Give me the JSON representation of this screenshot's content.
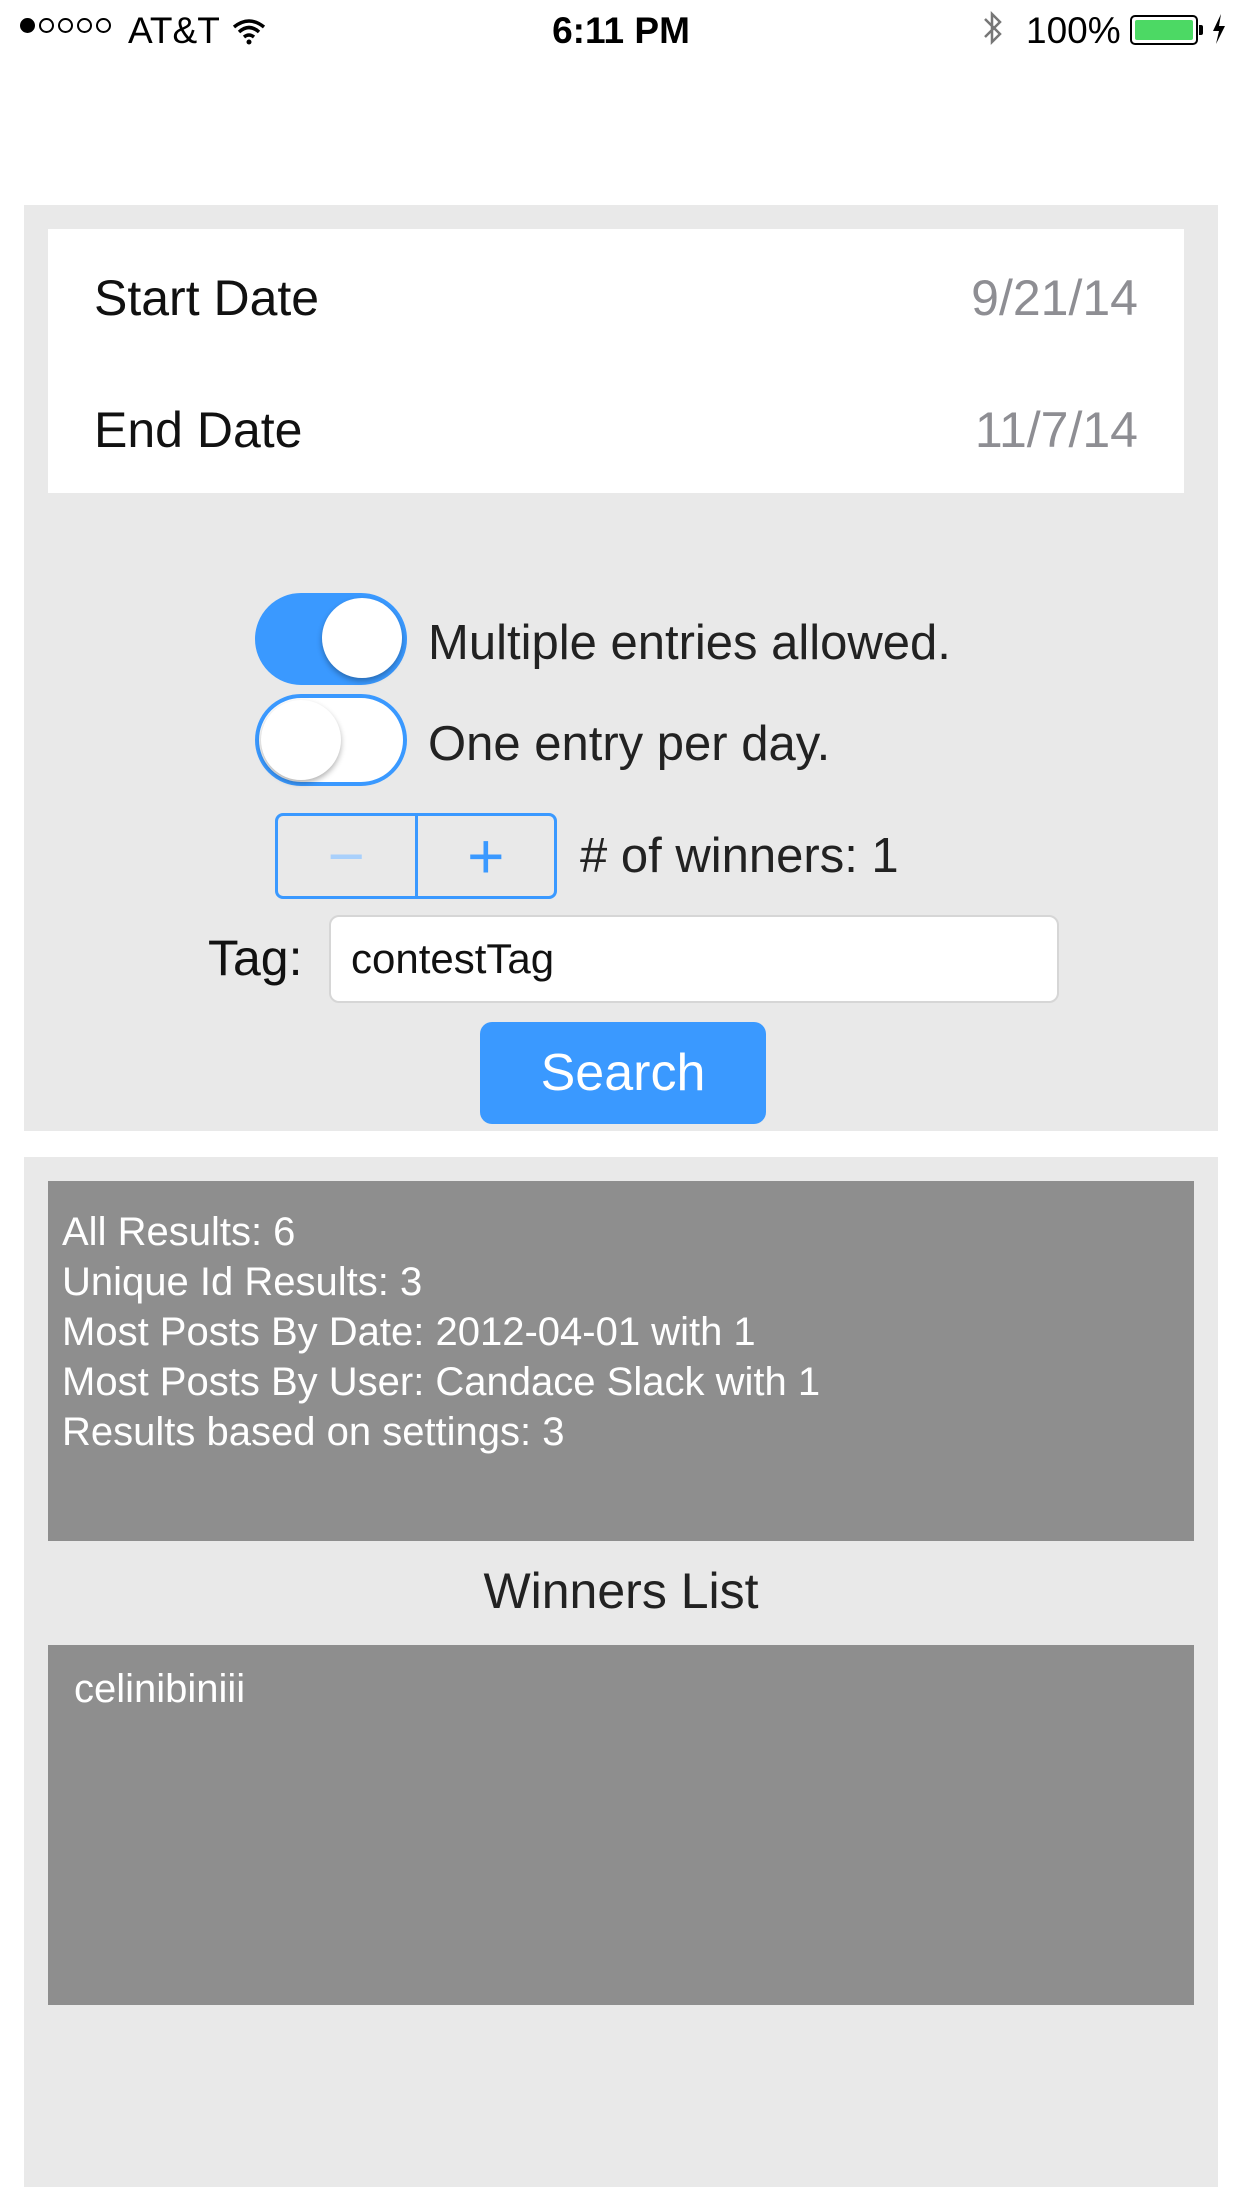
{
  "status_bar": {
    "carrier": "AT&T",
    "time": "6:11 PM",
    "battery": "100%",
    "signal_bars_filled": 1,
    "signal_bars_total": 5,
    "battery_color": "#4cd964"
  },
  "dates": {
    "start_label": "Start Date",
    "start_value": "9/21/14",
    "end_label": "End Date",
    "end_value": "11/7/14"
  },
  "options": {
    "multiple_entries_label": "Multiple entries allowed.",
    "multiple_entries_on": true,
    "one_per_day_label": "One entry per day.",
    "one_per_day_on": false
  },
  "winners_stepper": {
    "minus_glyph": "−",
    "plus_glyph": "+",
    "label": "# of winners: 1"
  },
  "tag": {
    "label": "Tag:",
    "value": "contestTag"
  },
  "search_button": "Search",
  "results": {
    "lines": [
      "All Results: 6",
      "Unique Id Results: 3",
      "Most Posts By Date: 2012-04-01 with 1",
      "Most Posts By User: Candace Slack with 1",
      "Results based on settings: 3"
    ]
  },
  "winners": {
    "title": "Winners List",
    "list": [
      "celinibiniii"
    ]
  },
  "colors": {
    "accent": "#3a99ff",
    "panel_bg": "#e9e9e9",
    "result_box_bg": "#8e8e8e"
  },
  "icons": {
    "wifi": "wifi-icon",
    "bluetooth": "bluetooth-icon",
    "charging": "charging-bolt-icon"
  }
}
